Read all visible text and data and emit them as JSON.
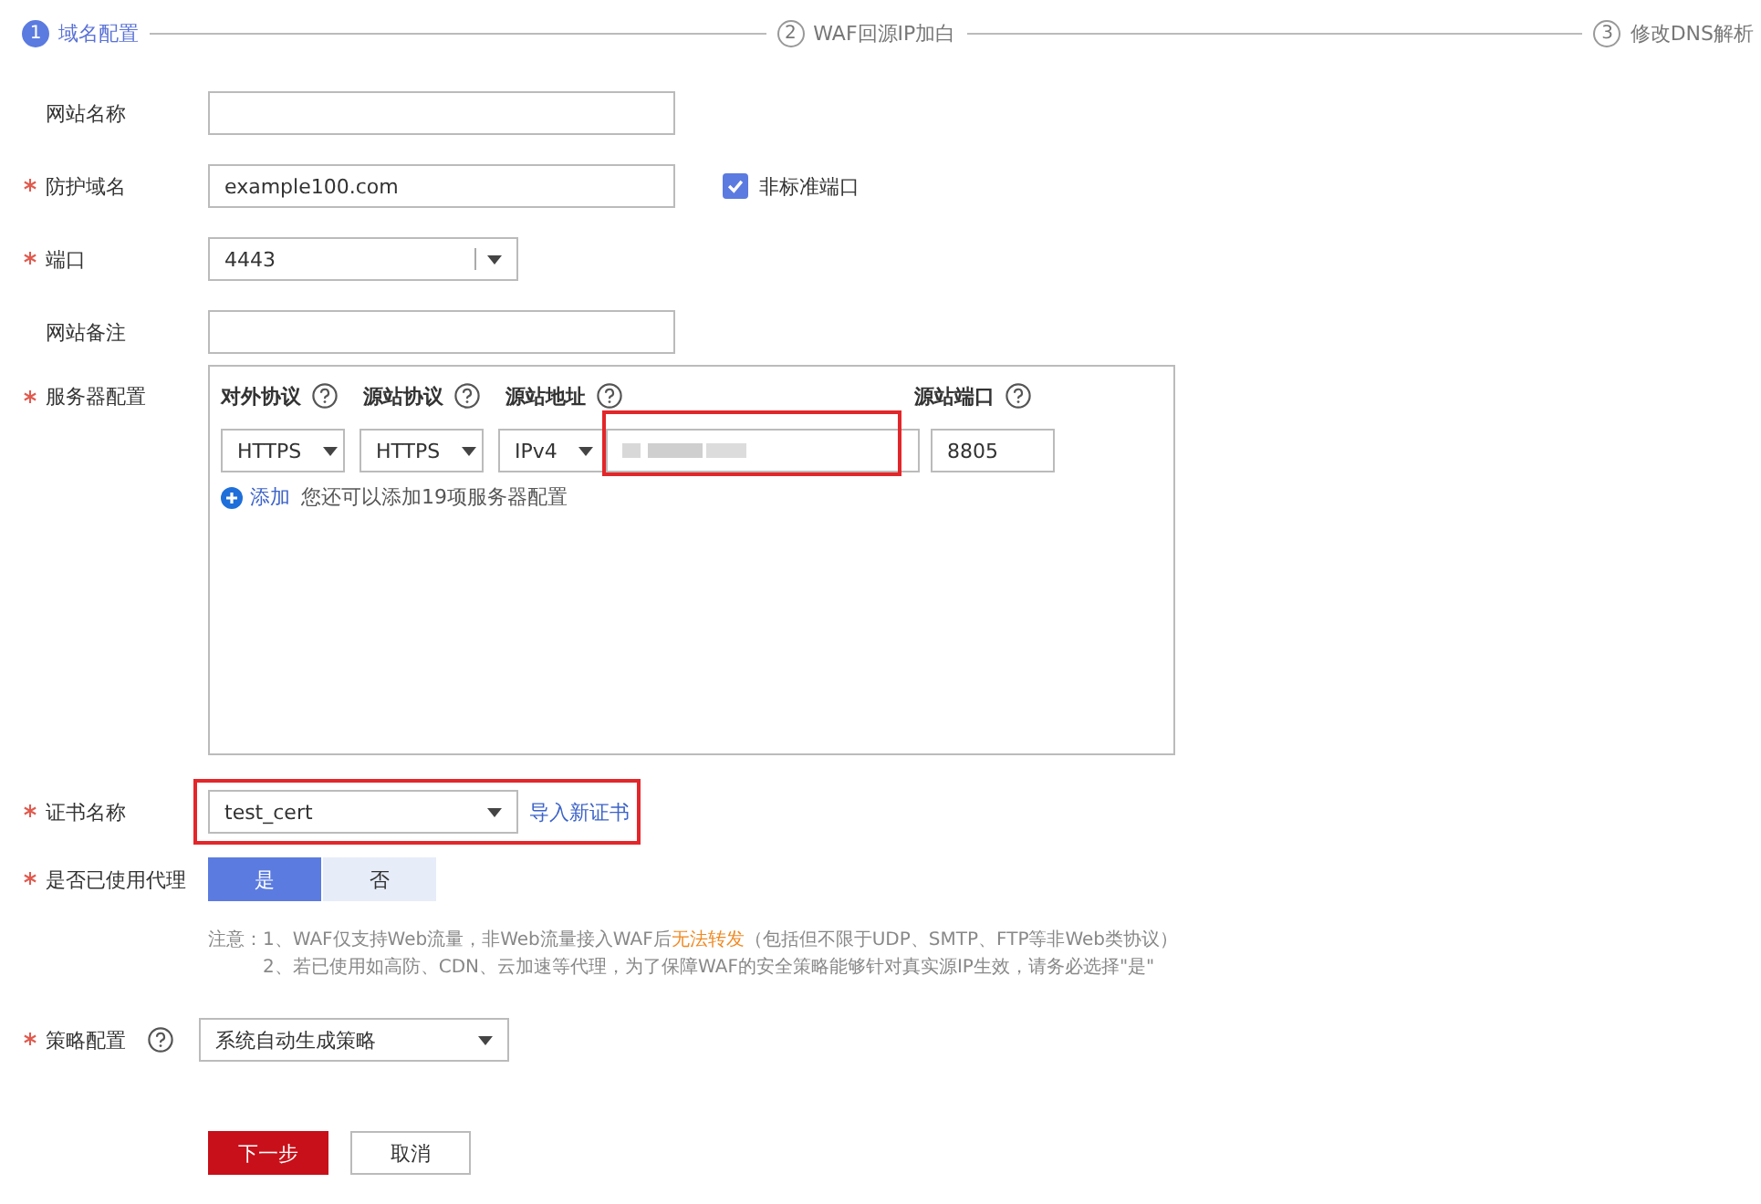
{
  "steps": [
    {
      "number": "1",
      "label": "域名配置",
      "selected": true
    },
    {
      "number": "2",
      "label": "WAF回源IP加白",
      "selected": false
    },
    {
      "number": "3",
      "label": "修改DNS解析",
      "selected": false
    }
  ],
  "fields": {
    "site_name": {
      "label": "网站名称",
      "required": false
    },
    "domain": {
      "label": "防护域名",
      "required": true,
      "value": "example100.com",
      "checkbox": {
        "label": "非标准端口",
        "checked": true
      }
    },
    "port": {
      "label": "端口",
      "required": true,
      "value": "4443"
    },
    "remark": {
      "label": "网站备注",
      "required": false
    },
    "server": {
      "label": "服务器配置",
      "required": true,
      "columns": [
        "对外协议",
        "源站协议",
        "源站地址",
        "源站端口"
      ],
      "row": {
        "client_protocol": "HTTPS",
        "server_protocol": "HTTPS",
        "address_type": "IPv4",
        "port": "8805"
      },
      "add_link": "添加",
      "add_hint": "您还可以添加19项服务器配置"
    },
    "certificate": {
      "label": "证书名称",
      "required": true,
      "value": "test_cert",
      "import_link": "导入新证书"
    },
    "proxy": {
      "label": "是否已使用代理",
      "required": true,
      "options": [
        {
          "label": "是",
          "selected": true
        },
        {
          "label": "否",
          "selected": false
        }
      ]
    },
    "note": {
      "prefix": "注意：",
      "line1_before": "1、WAF仅支持Web流量，非Web流量接入WAF后",
      "line1_warning": "无法转发",
      "line1_after": "（包括但不限于UDP、SMTP、FTP等非Web类协议）",
      "line2": "2、若已使用如高防、CDN、云加速等代理，为了保障WAF的安全策略能够针对真实源IP生效，请务必选择\"是\""
    },
    "policy": {
      "label": "策略配置",
      "required": true,
      "value": "系统自动生成策略"
    }
  },
  "buttons": {
    "next": "下一步",
    "cancel": "取消"
  }
}
